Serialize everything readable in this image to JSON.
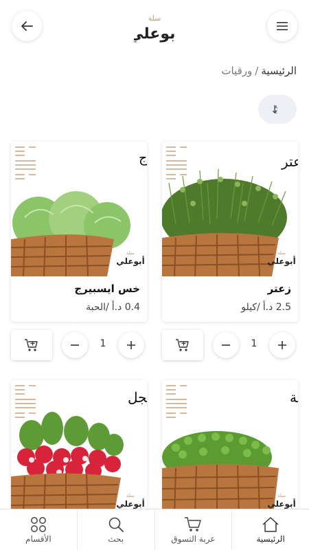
{
  "header": {
    "menu_icon": "menu-icon",
    "back_icon": "arrow-left-icon",
    "logo_text": "سلة أبو علي"
  },
  "breadcrumb": {
    "home": "الرئيسية",
    "separator": "/",
    "current": "ورقيات"
  },
  "sort": {
    "icon": "sort-icon"
  },
  "products": [
    {
      "image_label": "زعتر",
      "name": "زعتر",
      "price": "2.5 د.أ",
      "unit": "/كيلو",
      "qty": "1",
      "produce": "thyme"
    },
    {
      "image_label": "خس ايسبرج",
      "name": "خس ايسبيرج",
      "price": "0.4 د.أ",
      "unit": "/الحبة",
      "qty": "1",
      "produce": "lettuce"
    },
    {
      "image_label": "بـقلة",
      "produce": "purslane"
    },
    {
      "image_label": "فجل",
      "produce": "radish"
    }
  ],
  "bottom_nav": [
    {
      "label": "الرئيسية",
      "icon": "home-icon"
    },
    {
      "label": "عربة التسوق",
      "icon": "cart-icon"
    },
    {
      "label": "بحث",
      "icon": "search-icon"
    },
    {
      "label": "الأقسام",
      "icon": "grid-icon"
    }
  ],
  "colors": {
    "basket": "#b8753d",
    "basket_dark": "#8a4f24",
    "brand": "#c69b7b",
    "bg_sort": "#eef0f5"
  }
}
